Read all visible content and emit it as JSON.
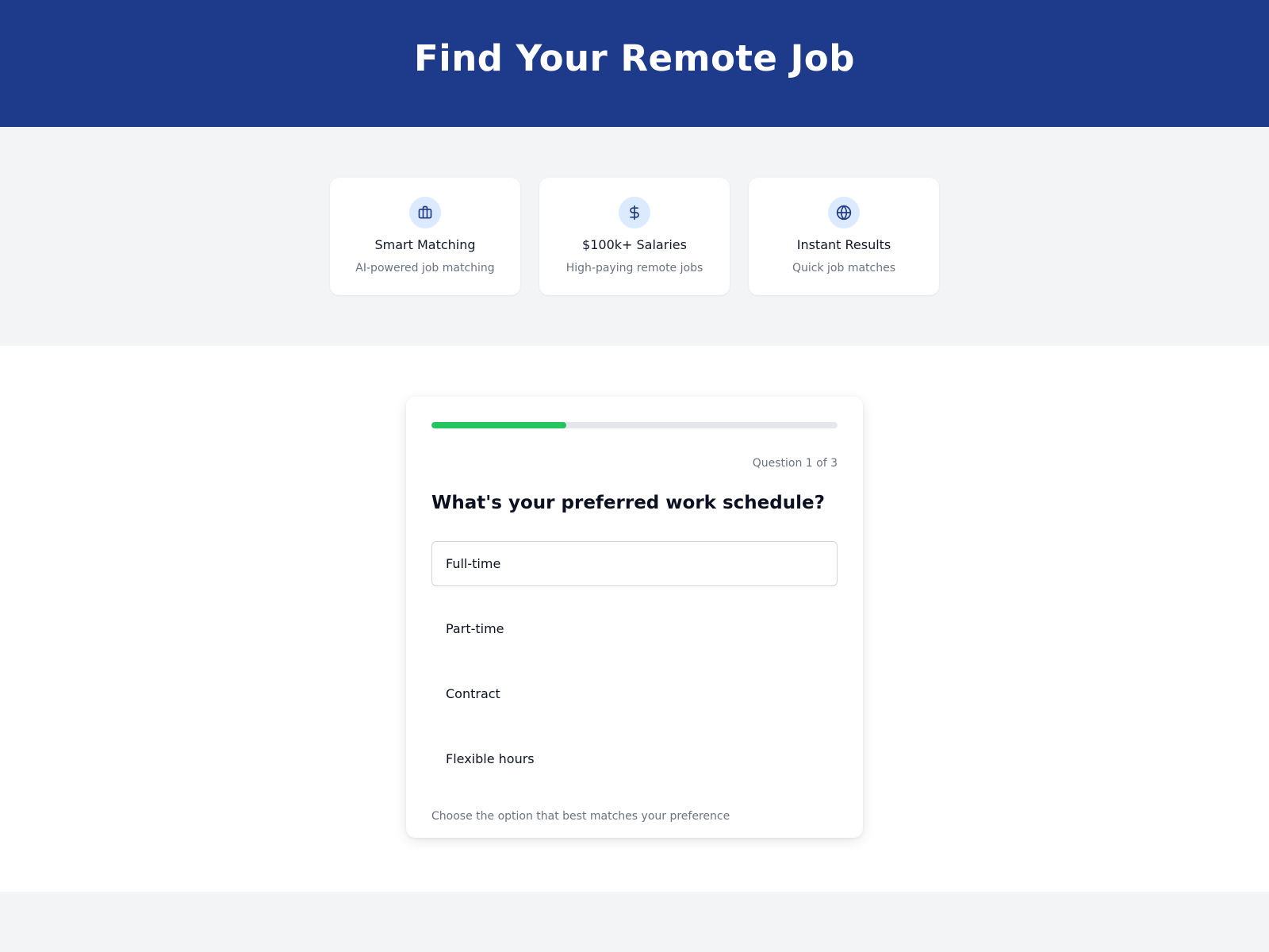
{
  "header": {
    "title": "Find Your Remote Job"
  },
  "features": [
    {
      "icon": "briefcase-icon",
      "title": "Smart Matching",
      "description": "AI-powered job matching"
    },
    {
      "icon": "dollar-icon",
      "title": "$100k+ Salaries",
      "description": "High-paying remote jobs"
    },
    {
      "icon": "globe-icon",
      "title": "Instant Results",
      "description": "Quick job matches"
    }
  ],
  "quiz": {
    "progress_fraction": 0.333,
    "counter": "Question 1 of 3",
    "question": "What's your preferred work schedule?",
    "options": [
      "Full-time",
      "Part-time",
      "Contract",
      "Flexible hours"
    ],
    "selected_option": "Full-time",
    "helper": "Choose the option that best matches your preference"
  },
  "colors": {
    "header_bg": "#1e3a8a",
    "progress": "#22c55e",
    "icon_bg": "#dbeafe",
    "icon_stroke": "#1e3a8a"
  }
}
